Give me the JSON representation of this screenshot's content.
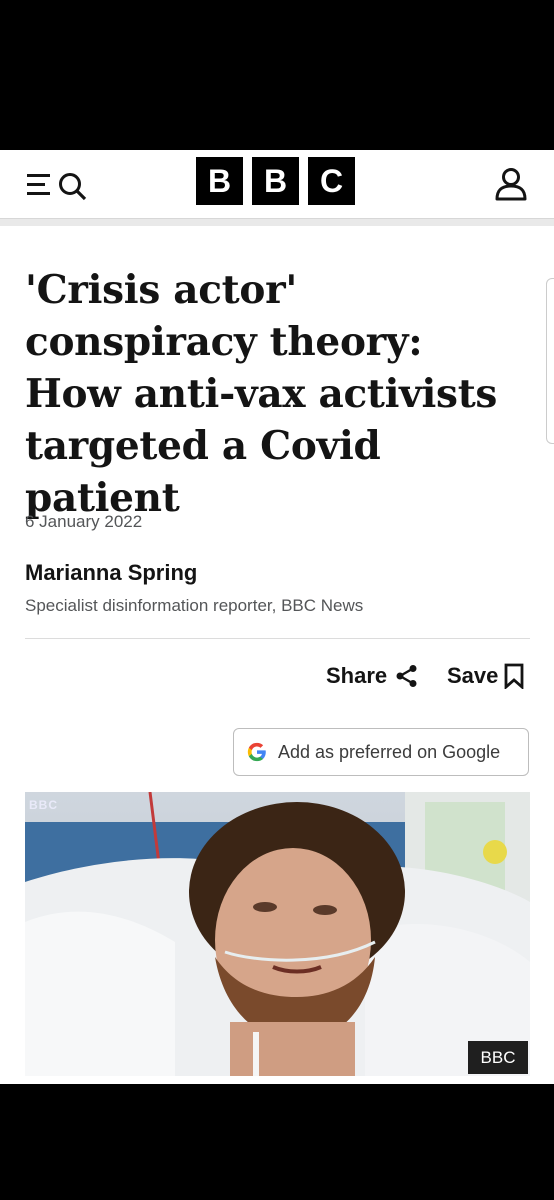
{
  "header": {
    "logo_letters": [
      "B",
      "B",
      "C"
    ],
    "menu_icon": "menu-icon",
    "search_icon": "search-icon",
    "account_icon": "user-icon"
  },
  "article": {
    "headline": "'Crisis actor' conspiracy theory: How anti-vax activists targeted a Covid patient",
    "date": "6 January 2022",
    "author": "Marianna Spring",
    "author_role": "Specialist disinformation reporter, BBC News"
  },
  "actions": {
    "share_label": "Share",
    "share_icon": "share-icon",
    "save_label": "Save",
    "save_icon": "bookmark-icon",
    "google_label": "Add as preferred on Google",
    "google_icon": "google-g-icon"
  },
  "image": {
    "badge": "BBC",
    "watermark": "BBC"
  },
  "colors": {
    "text": "#141414",
    "muted": "#545658",
    "brand_black": "#000000"
  }
}
